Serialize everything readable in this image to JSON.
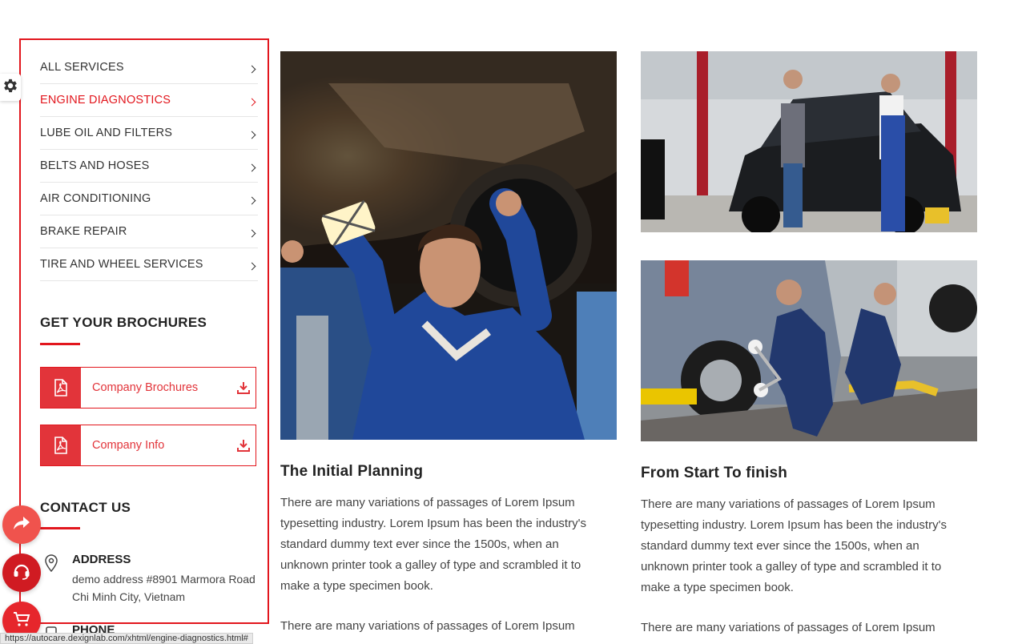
{
  "services": {
    "items": [
      {
        "label": "ALL SERVICES",
        "active": false
      },
      {
        "label": "ENGINE DIAGNOSTICS",
        "active": true
      },
      {
        "label": "LUBE OIL AND FILTERS",
        "active": false
      },
      {
        "label": "BELTS AND HOSES",
        "active": false
      },
      {
        "label": "AIR CONDITIONING",
        "active": false
      },
      {
        "label": "BRAKE REPAIR",
        "active": false
      },
      {
        "label": "TIRE AND WHEEL SERVICES",
        "active": false
      }
    ]
  },
  "brochures": {
    "title": "GET YOUR BROCHURES",
    "items": [
      {
        "label": "Company Brochures"
      },
      {
        "label": "Company Info"
      }
    ]
  },
  "contact": {
    "title": "CONTACT US",
    "address_title": "ADDRESS",
    "address_text": "demo address #8901 Marmora Road Chi Minh City, Vietnam",
    "phone_title": "PHONE"
  },
  "cards": [
    {
      "title": "The Initial Planning",
      "paragraph1": "There are many variations of passages of Lorem Ipsum typesetting industry. Lorem Ipsum has been the industry's standard dummy text ever since the 1500s, when an unknown printer took a galley of type and scrambled it to make a type specimen book.",
      "paragraph2": "There are many variations of passages of Lorem Ipsum"
    },
    {
      "title": "From Start To finish",
      "paragraph1": "There are many variations of passages of Lorem Ipsum typesetting industry. Lorem Ipsum has been the industry's standard dummy text ever since the 1500s, when an unknown printer took a galley of type and scrambled it to make a type specimen book.",
      "paragraph2": "There are many variations of passages of Lorem Ipsum"
    }
  ],
  "status_bar": {
    "url": "https://autocare.dexignlab.com/xhtml/engine-diagnostics.html#"
  },
  "icons": {
    "settings": "gear-icon",
    "share": "share-icon",
    "support": "headset-icon",
    "cart": "cart-icon",
    "pdf": "pdf-icon",
    "download": "download-icon",
    "location": "location-pin-icon",
    "phone": "phone-icon"
  },
  "colors": {
    "accent": "#e2161d",
    "brochure_red": "#e2343a",
    "text": "#333333"
  }
}
